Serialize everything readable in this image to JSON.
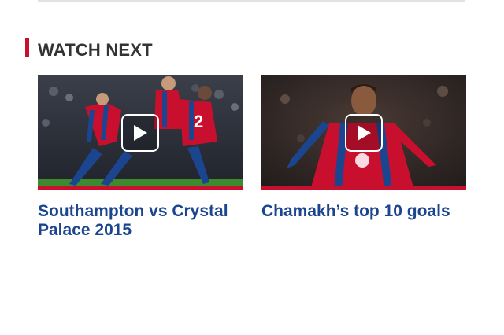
{
  "section": {
    "title": "WATCH NEXT"
  },
  "colors": {
    "accent": "#c8102e",
    "link": "#1b458f",
    "heading": "#333333"
  },
  "videos": [
    {
      "title": "Southampton vs Crystal Palace 2015",
      "thumbnail_icon": "play-icon"
    },
    {
      "title": "Chamakh’s top 10 goals",
      "thumbnail_icon": "play-icon"
    }
  ]
}
